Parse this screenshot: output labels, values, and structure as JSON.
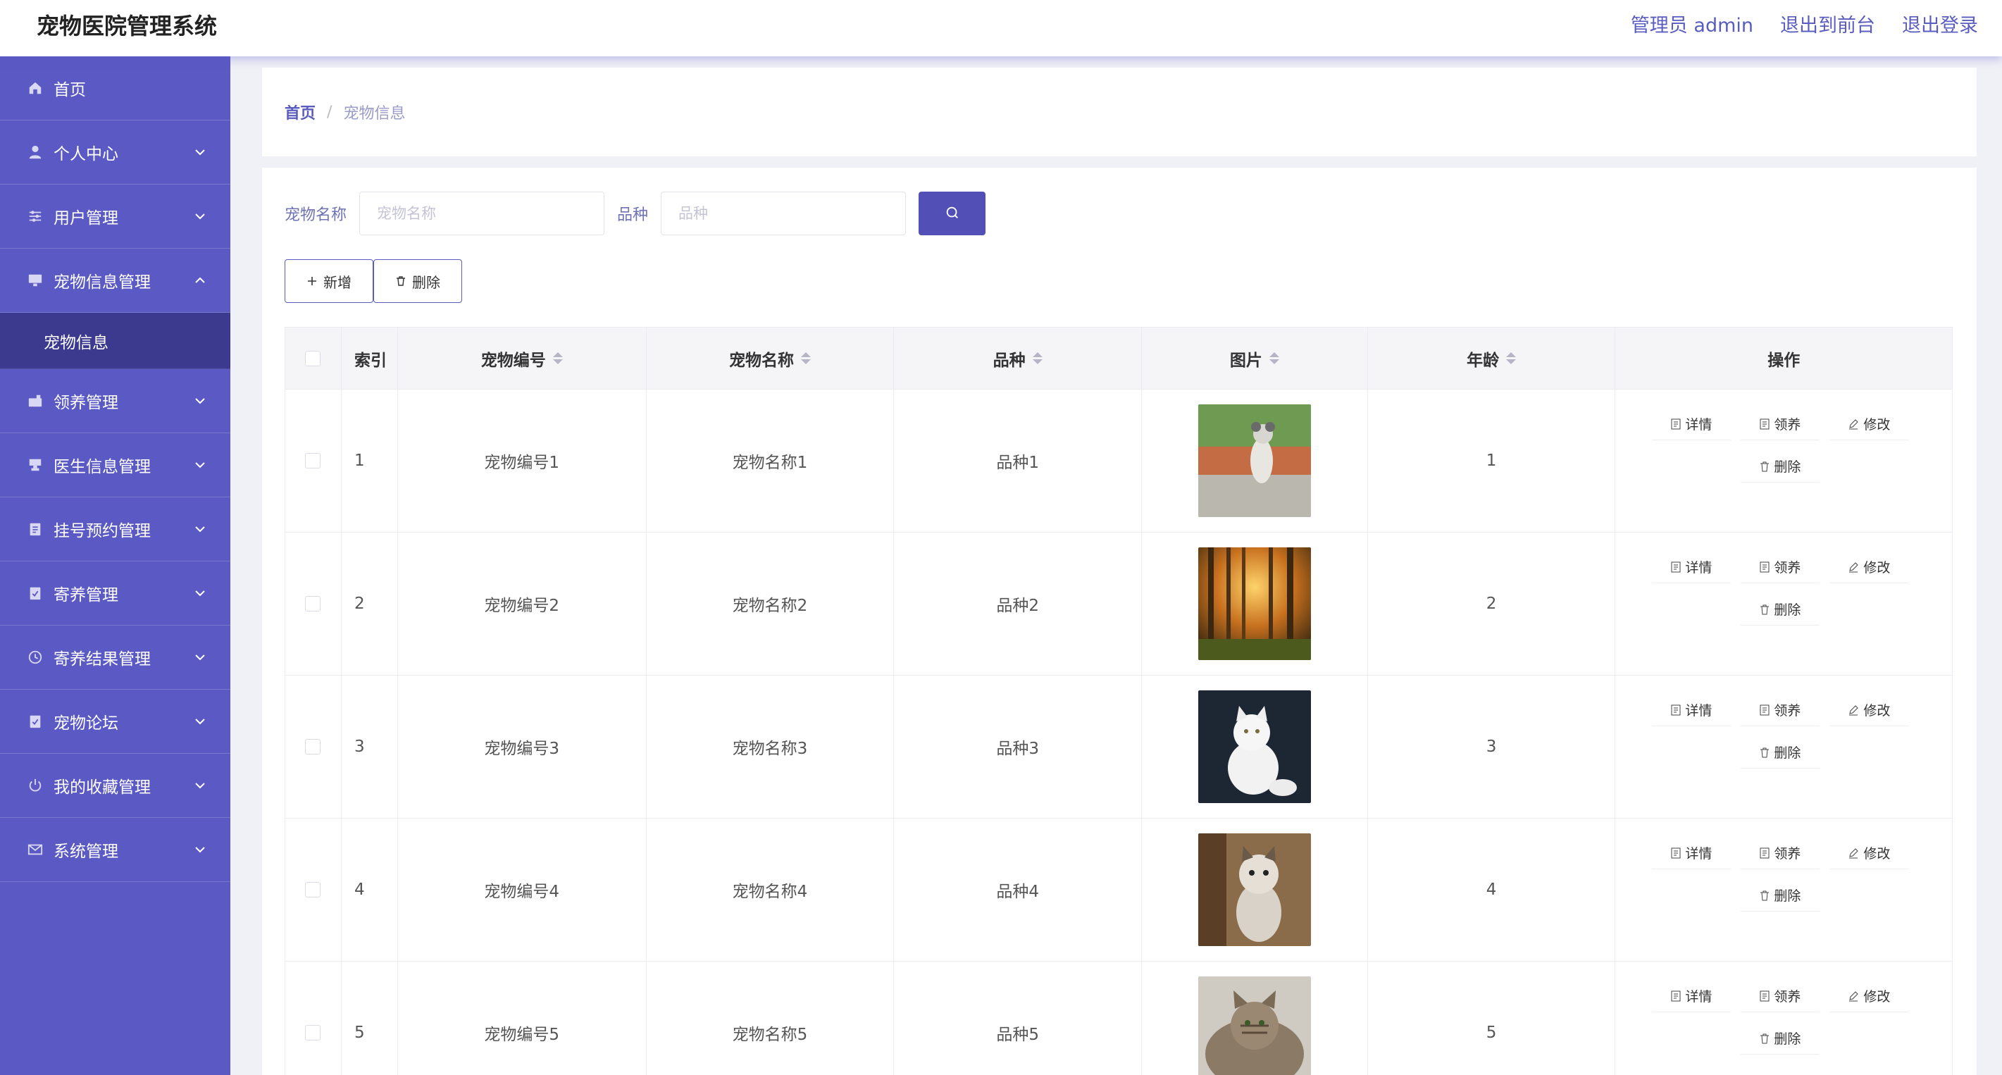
{
  "header": {
    "title": "宠物医院管理系统",
    "admin_label": "管理员 admin",
    "front_link": "退出到前台",
    "logout_link": "退出登录"
  },
  "sidebar": {
    "items": [
      {
        "label": "首页",
        "icon": "home-icon"
      },
      {
        "label": "个人中心",
        "icon": "user-icon"
      },
      {
        "label": "用户管理",
        "icon": "sliders-icon"
      },
      {
        "label": "宠物信息管理",
        "icon": "monitor-icon",
        "expanded": true
      },
      {
        "label": "领养管理",
        "icon": "briefcase-icon"
      },
      {
        "label": "医生信息管理",
        "icon": "stamp-icon"
      },
      {
        "label": "挂号预约管理",
        "icon": "clipboard-icon"
      },
      {
        "label": "寄养管理",
        "icon": "check-clipboard-icon"
      },
      {
        "label": "寄养结果管理",
        "icon": "clock-icon"
      },
      {
        "label": "宠物论坛",
        "icon": "forum-icon"
      },
      {
        "label": "我的收藏管理",
        "icon": "power-icon"
      },
      {
        "label": "系统管理",
        "icon": "mail-icon"
      }
    ],
    "submenu_active": "宠物信息"
  },
  "breadcrumb": {
    "home": "首页",
    "separator": "/",
    "current": "宠物信息"
  },
  "search": {
    "name_label": "宠物名称",
    "name_placeholder": "宠物名称",
    "breed_label": "品种",
    "breed_placeholder": "品种"
  },
  "actions": {
    "add_label": "新增",
    "delete_label": "删除"
  },
  "table": {
    "headers": {
      "index": "索引",
      "code": "宠物编号",
      "name": "宠物名称",
      "breed": "品种",
      "image": "图片",
      "age": "年龄",
      "ops": "操作"
    },
    "rows": [
      {
        "index": "1",
        "code": "宠物编号1",
        "name": "宠物名称1",
        "breed": "品种1",
        "image": "dog-photo",
        "age": "1"
      },
      {
        "index": "2",
        "code": "宠物编号2",
        "name": "宠物名称2",
        "breed": "品种2",
        "image": "forest-photo",
        "age": "2"
      },
      {
        "index": "3",
        "code": "宠物编号3",
        "name": "宠物名称3",
        "breed": "品种3",
        "image": "white-cat-photo",
        "age": "3"
      },
      {
        "index": "4",
        "code": "宠物编号4",
        "name": "宠物名称4",
        "breed": "品种4",
        "image": "sitting-cat-photo",
        "age": "4"
      },
      {
        "index": "5",
        "code": "宠物编号5",
        "name": "宠物名称5",
        "breed": "品种5",
        "image": "tabby-cat-photo",
        "age": "5"
      }
    ],
    "row_ops": {
      "detail": "详情",
      "adopt": "领养",
      "edit": "修改",
      "delete": "删除"
    }
  },
  "colors": {
    "accent": "#5b59c3",
    "accent_dark": "#3b3a8f",
    "link": "#5a5cc0"
  }
}
